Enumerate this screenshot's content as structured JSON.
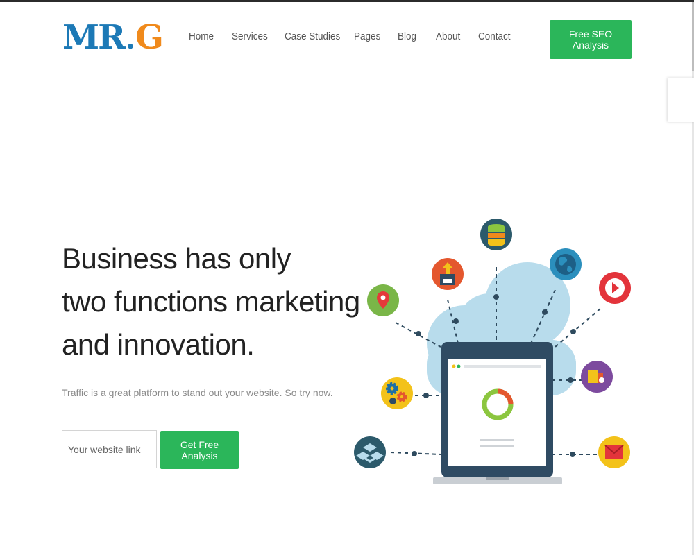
{
  "logo": {
    "part1": "MR",
    "dot": ".",
    "part2": "G"
  },
  "nav": {
    "items": [
      {
        "label": "Home"
      },
      {
        "label": "Services"
      },
      {
        "label": "Case Studies"
      },
      {
        "label": "Pages"
      },
      {
        "label": "Blog"
      },
      {
        "label": "About"
      },
      {
        "label": "Contact"
      }
    ]
  },
  "header": {
    "cta_label": "Free SEO Analysis"
  },
  "hero": {
    "headline_lines": [
      "Business has only",
      "two functions marketing",
      "and innovation."
    ],
    "subtext": "Traffic is a great platform to stand out your website. So try now.",
    "input_placeholder": "Your website link",
    "button_label": "Get Free Analysis"
  },
  "illustration": {
    "icons": [
      "location-pin-icon",
      "upload-floppy-icon",
      "database-icon",
      "globe-icon",
      "play-icon",
      "gears-icon",
      "box-icon",
      "dropbox-icon",
      "mail-icon"
    ]
  },
  "colors": {
    "accent_green": "#2bb65a",
    "logo_blue": "#1c79b6",
    "logo_orange": "#f08a1c"
  }
}
